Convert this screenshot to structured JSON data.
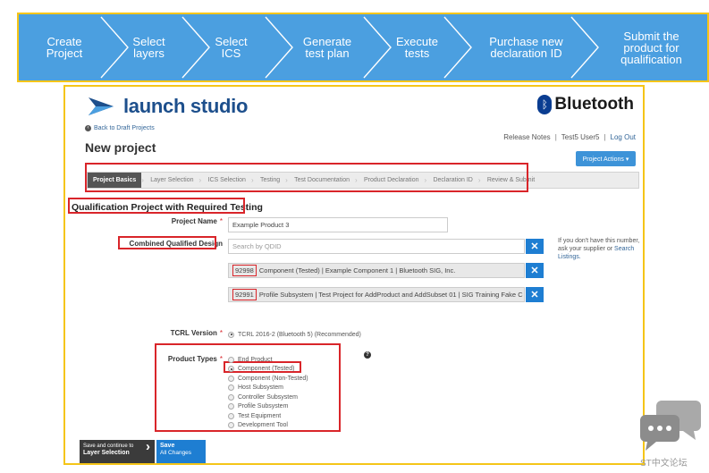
{
  "process_banner": {
    "steps": [
      "Create\nProject",
      "Select\nlayers",
      "Select\nICS",
      "Generate\ntest plan",
      "Execute\ntests",
      "Purchase new\ndeclaration ID",
      "Submit the\nproduct for\nqualification"
    ]
  },
  "header": {
    "logo_text": "launch studio",
    "bluetooth_text": "Bluetooth",
    "back_link": "Back to Draft Projects",
    "page_title": "New project",
    "links": {
      "release_notes": "Release Notes",
      "user": "Test5 User5",
      "logout": "Log Out"
    },
    "project_actions": "Project Actions ▾"
  },
  "tabs": [
    "Project Basics",
    "Layer Selection",
    "ICS Selection",
    "Testing",
    "Test Documentation",
    "Product Declaration",
    "Declaration ID",
    "Review & Submit"
  ],
  "form": {
    "section_title": "Qualification Project with Required Testing",
    "project_name_label": "Project Name",
    "project_name_value": "Example Product 3",
    "combined_label": "Combined Qualified Design",
    "search_placeholder": "Search by QDID",
    "hint_text": "If you don't have this number, ask your supplier or",
    "hint_link": "Search Listings.",
    "designs": [
      {
        "qdid": "92998",
        "text": "Component (Tested) | Example Component 1 | Bluetooth SIG, Inc."
      },
      {
        "qdid": "92991",
        "text": "Profile Subsystem | Test Project for AddProduct and AddSubset 01 | SIG Training Fake C"
      }
    ],
    "tcrl_label": "TCRL Version",
    "tcrl_value": "TCRL 2016-2 (Bluetooth 5) (Recommended)",
    "product_types_label": "Product Types",
    "product_types": [
      "End Product",
      "Component (Tested)",
      "Component (Non-Tested)",
      "Host Subsystem",
      "Controller Subsystem",
      "Profile Subsystem",
      "Test Equipment",
      "Development Tool"
    ],
    "product_types_selected": "Component (Tested)"
  },
  "footer": {
    "save_continue_line1": "Save and continue to",
    "save_continue_line2": "Layer Selection",
    "save_line1": "Save",
    "save_line2": "All Changes"
  },
  "watermark": "ST中文论坛",
  "colors": {
    "banner": "#4b9fe0",
    "highlight_red": "#d9252a",
    "highlight_yellow": "#f5c518",
    "primary_blue": "#1e7ed2"
  }
}
